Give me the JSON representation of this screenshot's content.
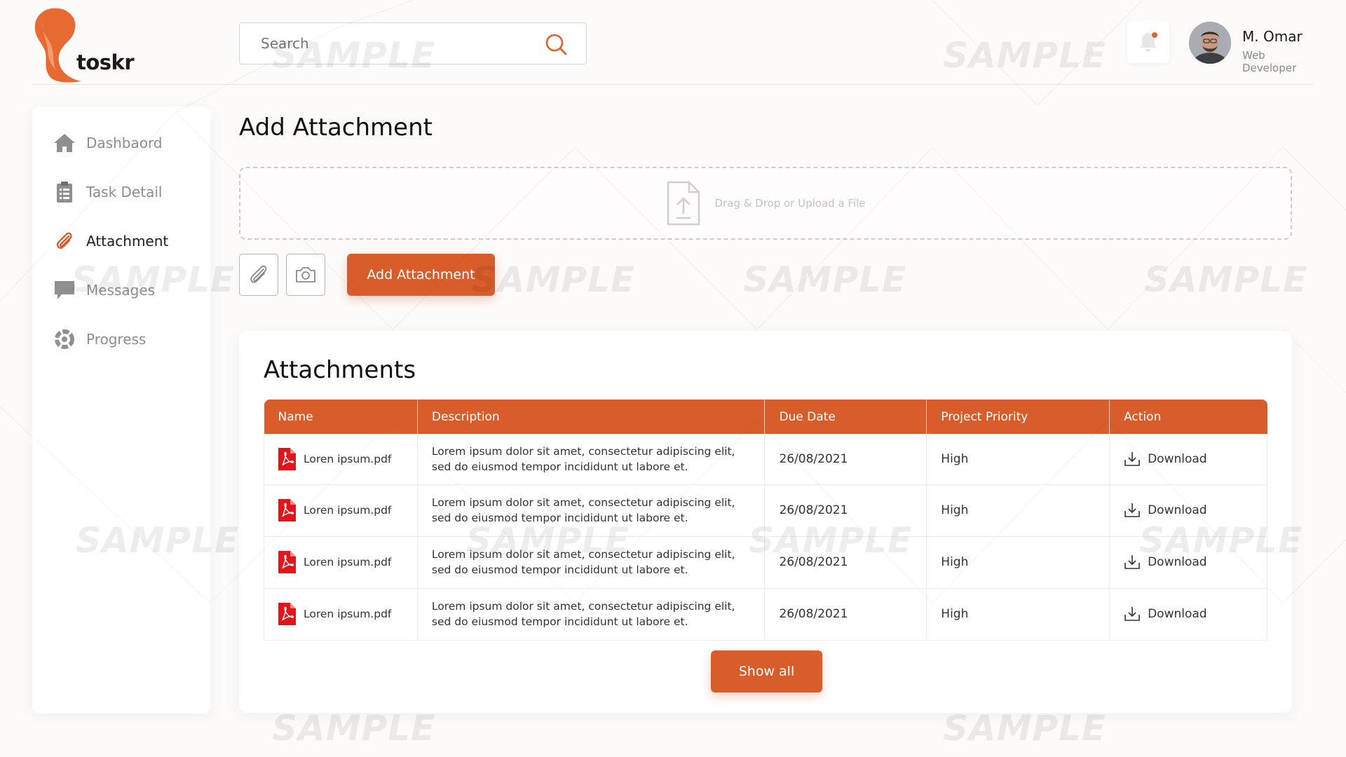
{
  "app": {
    "logo_text": "toskr"
  },
  "search": {
    "placeholder": "Search"
  },
  "user": {
    "name": "M. Omar",
    "role": "Web Developer"
  },
  "sidebar": {
    "items": [
      {
        "label": "Dashbaord",
        "icon": "home-icon"
      },
      {
        "label": "Task Detail",
        "icon": "clipboard-icon"
      },
      {
        "label": "Attachment",
        "icon": "paperclip-icon",
        "active": true
      },
      {
        "label": "Messages",
        "icon": "chat-icon"
      },
      {
        "label": "Progress",
        "icon": "progress-icon"
      }
    ]
  },
  "main": {
    "title": "Add Attachment",
    "dropzone_label": "Drag & Drop or Upload a File",
    "add_button": "Add Attachment"
  },
  "attachments": {
    "title": "Attachments",
    "columns": [
      "Name",
      "Description",
      "Due Date",
      "Project Priority",
      "Action"
    ],
    "rows": [
      {
        "name": "Loren ipsum.pdf",
        "desc1": "Lorem ipsum dolor sit amet, consectetur adipiscing elit,",
        "desc2": "sed do eiusmod tempor incididunt ut labore et.",
        "due": "26/08/2021",
        "priority": "High",
        "action": "Download"
      },
      {
        "name": "Loren ipsum.pdf",
        "desc1": "Lorem ipsum dolor sit amet, consectetur adipiscing elit,",
        "desc2": "sed do eiusmod tempor incididunt ut labore et.",
        "due": "26/08/2021",
        "priority": "High",
        "action": "Download"
      },
      {
        "name": "Loren ipsum.pdf",
        "desc1": "Lorem ipsum dolor sit amet, consectetur adipiscing elit,",
        "desc2": "sed do eiusmod tempor incididunt ut labore et.",
        "due": "26/08/2021",
        "priority": "High",
        "action": "Download"
      },
      {
        "name": "Loren ipsum.pdf",
        "desc1": "Lorem ipsum dolor sit amet, consectetur adipiscing elit,",
        "desc2": "sed do eiusmod tempor incididunt ut labore et.",
        "due": "26/08/2021",
        "priority": "High",
        "action": "Download"
      }
    ],
    "show_all": "Show all"
  },
  "watermark": "SAMPLE",
  "colors": {
    "accent": "#d95d2b",
    "pdf_red": "#e4141b",
    "notification_dot": "#e8622e"
  }
}
